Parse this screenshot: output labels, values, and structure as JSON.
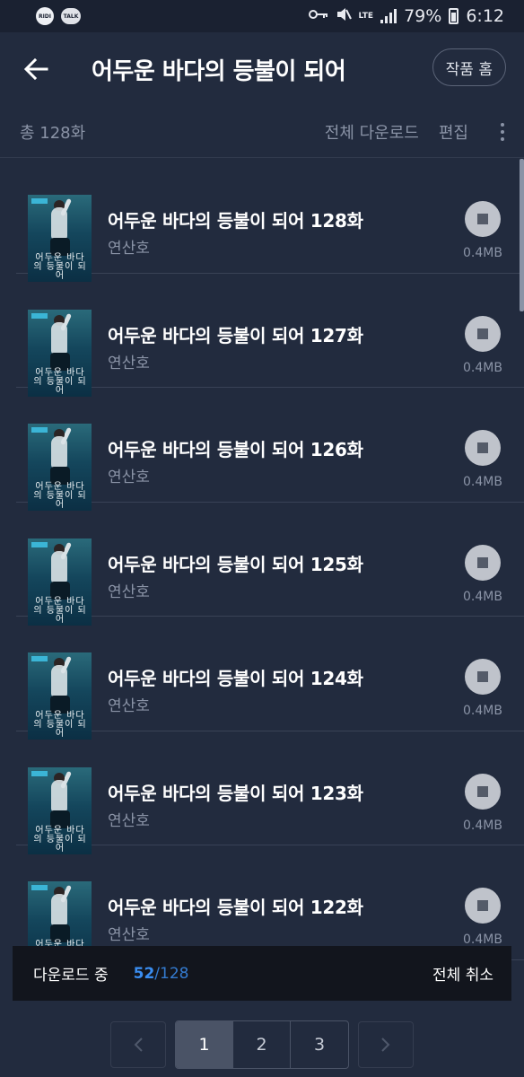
{
  "status_bar": {
    "app_icon_1": "RIDI",
    "app_icon_2": "TALK",
    "lte": "LTE",
    "battery": "79%",
    "time": "6:12"
  },
  "header": {
    "title": "어두운 바다의 등불이 되어",
    "home_button": "작품 홈"
  },
  "toolbar": {
    "total": "총 128화",
    "download_all": "전체 다운로드",
    "edit": "편집"
  },
  "thumbnail": {
    "cover_text": "어두운 바다의 등불이 되어"
  },
  "episodes": [
    {
      "title": "어두운 바다의 등불이 되어 128화",
      "author": "연산호",
      "size": "0.4MB"
    },
    {
      "title": "어두운 바다의 등불이 되어 127화",
      "author": "연산호",
      "size": "0.4MB"
    },
    {
      "title": "어두운 바다의 등불이 되어 126화",
      "author": "연산호",
      "size": "0.4MB"
    },
    {
      "title": "어두운 바다의 등불이 되어 125화",
      "author": "연산호",
      "size": "0.4MB"
    },
    {
      "title": "어두운 바다의 등불이 되어 124화",
      "author": "연산호",
      "size": "0.4MB"
    },
    {
      "title": "어두운 바다의 등불이 되어 123화",
      "author": "연산호",
      "size": "0.4MB"
    },
    {
      "title": "어두운 바다의 등불이 되어 122화",
      "author": "연산호",
      "size": "0.4MB"
    }
  ],
  "download_bar": {
    "label": "다운로드 중",
    "current": "52",
    "separator": "/",
    "total": "128",
    "cancel_all": "전체 취소"
  },
  "pagination": {
    "pages": [
      "1",
      "2",
      "3"
    ],
    "active_page": "1"
  }
}
